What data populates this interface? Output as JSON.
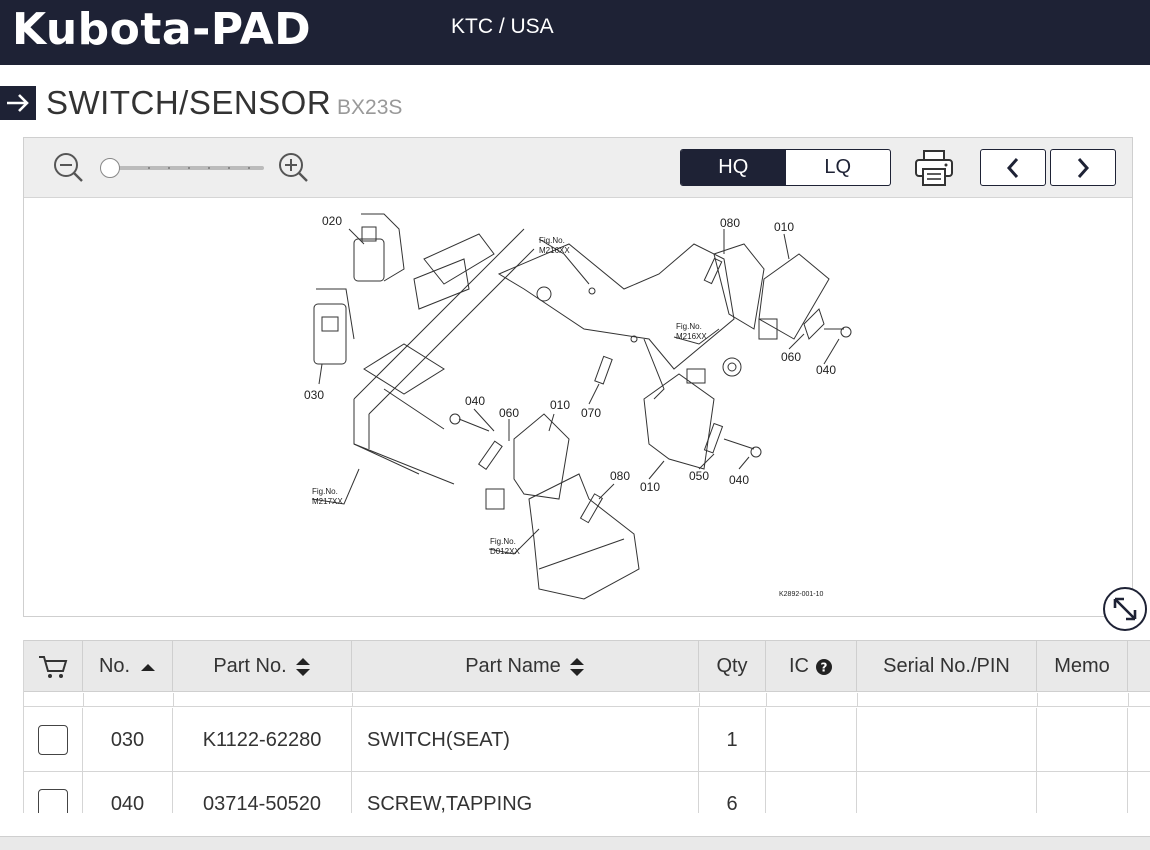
{
  "header": {
    "brand": "Kubota-PAD",
    "region": "KTC / USA"
  },
  "page": {
    "title": "SWITCH/SENSOR",
    "model": "BX23S"
  },
  "viewer": {
    "quality_options": [
      {
        "label": "HQ",
        "selected": true
      },
      {
        "label": "LQ",
        "selected": false
      }
    ],
    "zoom_level": 0,
    "icons": {
      "zoom_out": "zoom-out-icon",
      "zoom_in": "zoom-in-icon",
      "print": "printer-icon",
      "prev": "chevron-left-icon",
      "next": "chevron-right-icon",
      "expand": "expand-icon"
    },
    "diagram_labels": {
      "l020": "020",
      "l030": "030",
      "l010a": "010",
      "l080a": "080",
      "l060a": "060",
      "l040a": "040",
      "l040b": "040",
      "l060b": "060",
      "l010b": "010",
      "l070": "070",
      "l080b": "080",
      "l010c": "010",
      "l050": "050",
      "l040c": "040",
      "fig1a": "Fig.No.",
      "fig1b": "M216XX",
      "fig2a": "Fig.No.",
      "fig2b": "M216XX",
      "fig3a": "Fig.No.",
      "fig3b": "M217XX",
      "fig4a": "Fig.No.",
      "fig4b": "D012XX",
      "code": "K2892-001-10"
    }
  },
  "table": {
    "columns": {
      "no": "No.",
      "part_no": "Part No.",
      "part_name": "Part Name",
      "qty": "Qty",
      "ic": "IC",
      "serial": "Serial No./PIN",
      "memo": "Memo"
    },
    "rows": [
      {
        "no": "030",
        "part_no": "K1122-62280",
        "part_name": "SWITCH(SEAT)",
        "qty": "1",
        "ic": "",
        "serial": "",
        "memo": ""
      },
      {
        "no": "040",
        "part_no": "03714-50520",
        "part_name": "SCREW,TAPPING",
        "qty": "6",
        "ic": "",
        "serial": "",
        "memo": ""
      }
    ]
  },
  "colors": {
    "primary": "#1e2235",
    "header_bg": "#e9e9e9",
    "toolbar_bg": "#eeeeee"
  }
}
